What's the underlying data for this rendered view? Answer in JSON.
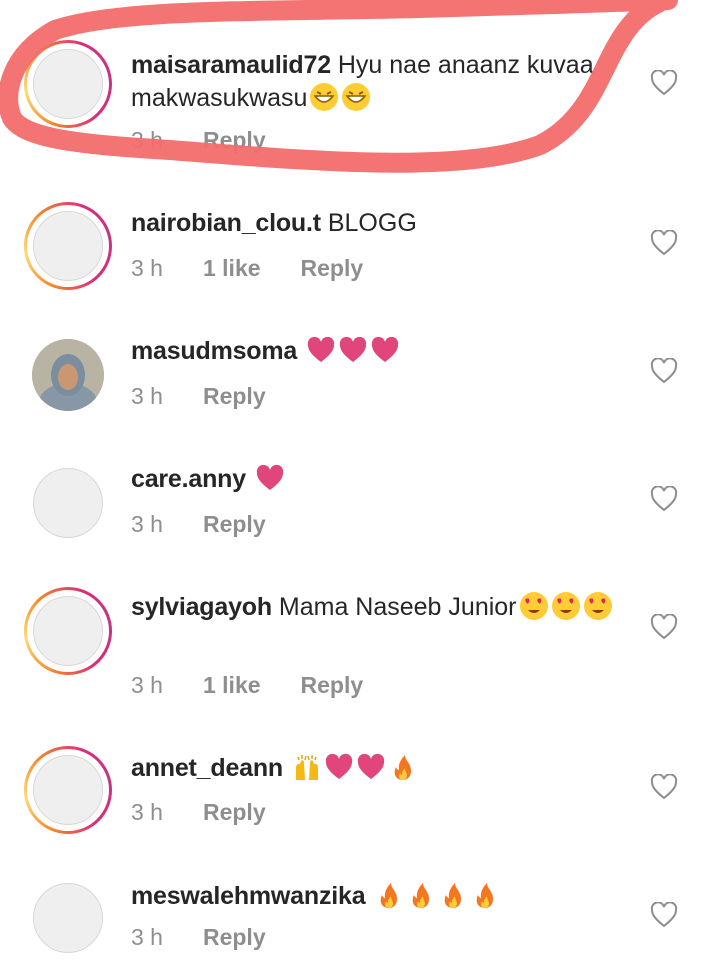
{
  "comments": [
    {
      "username": "maisaramaulid72",
      "text": "Hyu nae anaanz kuvaa makwasukwasu",
      "emojis": [
        "grin",
        "grin"
      ],
      "time": "3 h",
      "likes": "",
      "reply": "Reply",
      "avatar": "story-ring"
    },
    {
      "username": "nairobian_clou.t",
      "text": "BLOGG",
      "emojis": [],
      "time": "3 h",
      "likes": "1 like",
      "reply": "Reply",
      "avatar": "story-ring"
    },
    {
      "username": "masudmsoma",
      "text": "",
      "emojis": [
        "heart",
        "heart",
        "heart"
      ],
      "time": "3 h",
      "likes": "",
      "reply": "Reply",
      "avatar": "photo"
    },
    {
      "username": "care.anny",
      "text": "",
      "emojis": [
        "heart"
      ],
      "time": "3 h",
      "likes": "",
      "reply": "Reply",
      "avatar": "plain"
    },
    {
      "username": "sylviagayoh",
      "text": "Mama Naseeb Junior",
      "emojis": [
        "heart-eyes",
        "heart-eyes",
        "heart-eyes"
      ],
      "time": "3 h",
      "likes": "1 like",
      "reply": "Reply",
      "avatar": "story-ring"
    },
    {
      "username": "annet_deann",
      "text": "",
      "emojis": [
        "raised-hands",
        "heart",
        "heart",
        "fire"
      ],
      "time": "3 h",
      "likes": "",
      "reply": "Reply",
      "avatar": "story-ring"
    },
    {
      "username": "meswalehmwanzika",
      "text": "",
      "emojis": [
        "fire",
        "fire",
        "fire",
        "fire"
      ],
      "time": "3 h",
      "likes": "",
      "reply": "Reply",
      "avatar": "plain"
    }
  ],
  "colors": {
    "heart": "#e0457b",
    "annotation": "#f36b6b",
    "meta": "#8e8e8e"
  },
  "icons": {
    "like": "heart-outline-icon"
  }
}
